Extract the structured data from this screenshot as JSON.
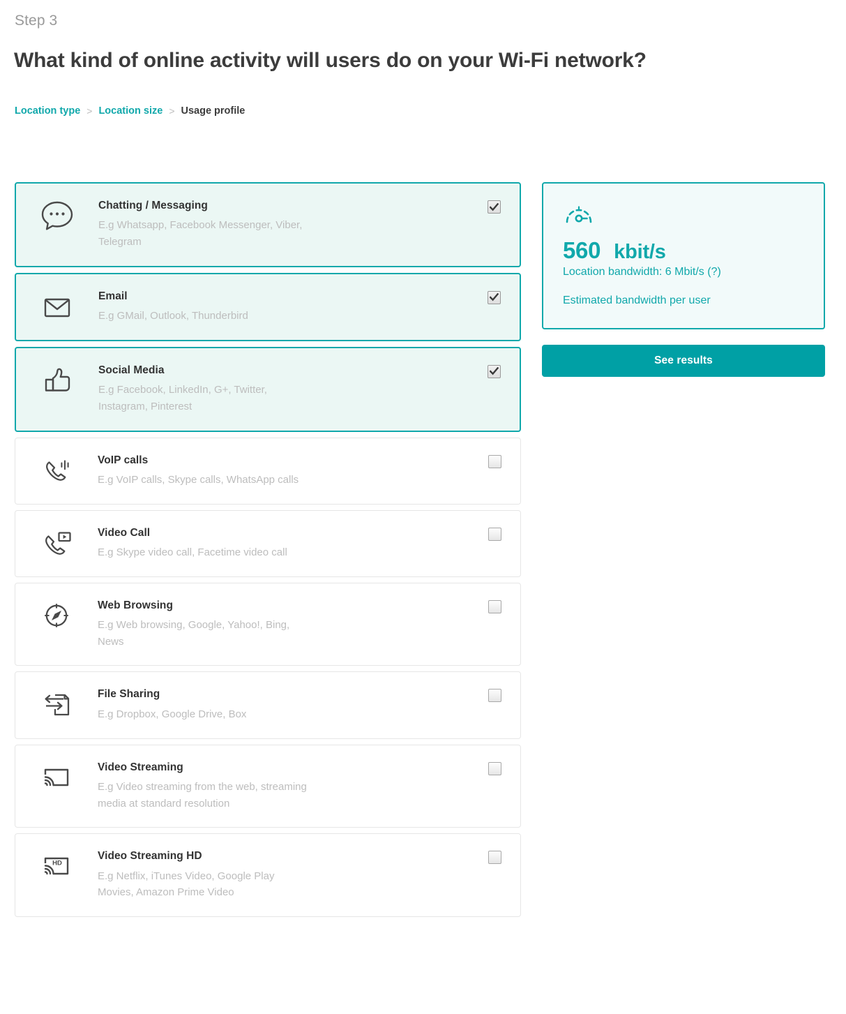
{
  "header": {
    "step_label": "Step 3",
    "title": "What kind of online activity will users do on your Wi-Fi network?"
  },
  "breadcrumb": {
    "separator": ">",
    "items": [
      {
        "label": "Location type",
        "current": false
      },
      {
        "label": "Location size",
        "current": false
      },
      {
        "label": "Usage profile",
        "current": true
      }
    ]
  },
  "colors": {
    "accent": "#11a8ab",
    "button": "#00a0a5",
    "selected_bg": "#ebf7f4",
    "panel_bg": "#f2fafa",
    "title_text": "#333333",
    "muted_text": "#bdbdbd"
  },
  "activities": [
    {
      "icon": "chat-bubble-icon",
      "title": "Chatting / Messaging",
      "description": "E.g Whatsapp, Facebook Messenger, Viber, Telegram",
      "selected": true
    },
    {
      "icon": "envelope-icon",
      "title": "Email",
      "description": "E.g GMail, Outlook, Thunderbird",
      "selected": true
    },
    {
      "icon": "thumbs-up-icon",
      "title": "Social Media",
      "description": "E.g Facebook, LinkedIn, G+, Twitter, Instagram, Pinterest",
      "selected": true
    },
    {
      "icon": "phone-waves-icon",
      "title": "VoIP calls",
      "description": "E.g VoIP calls, Skype calls, WhatsApp calls",
      "selected": false
    },
    {
      "icon": "phone-video-icon",
      "title": "Video Call",
      "description": "E.g Skype video call, Facetime video call",
      "selected": false
    },
    {
      "icon": "compass-icon",
      "title": "Web Browsing",
      "description": "E.g Web browsing, Google, Yahoo!, Bing, News",
      "selected": false
    },
    {
      "icon": "file-transfer-icon",
      "title": "File Sharing",
      "description": "E.g Dropbox, Google Drive, Box",
      "selected": false
    },
    {
      "icon": "cast-screen-icon",
      "title": "Video Streaming",
      "description": "E.g Video streaming from the web, streaming media at standard resolution",
      "selected": false
    },
    {
      "icon": "cast-screen-hd-icon",
      "title": "Video Streaming HD",
      "description": "E.g Netflix, iTunes Video, Google Play Movies, Amazon Prime Video",
      "selected": false
    }
  ],
  "bandwidth_panel": {
    "icon": "speedometer-icon",
    "value": "560",
    "unit": "kbit/s",
    "location_bandwidth": "Location bandwidth: 6 Mbit/s (?)",
    "note": "Estimated bandwidth per user"
  },
  "see_results_button": {
    "label": "See results"
  }
}
